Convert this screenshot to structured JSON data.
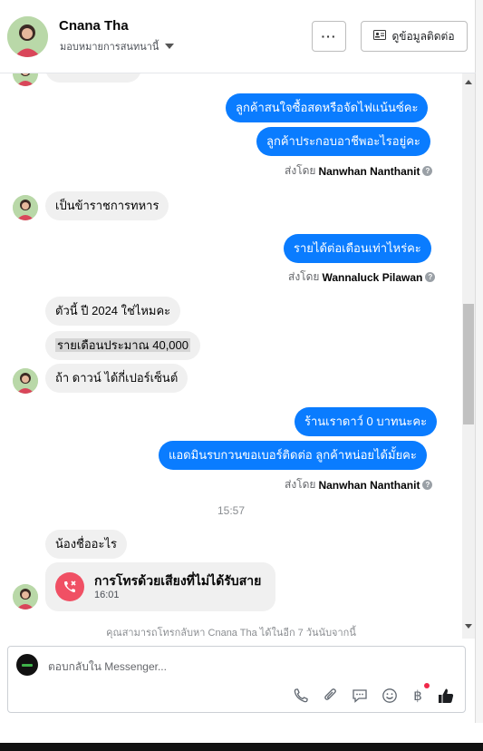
{
  "header": {
    "contact_name": "Cnana Tha",
    "assign_label": "มอบหมายการสนทนานี้",
    "more_label": "···",
    "contact_info_label": "ดูข้อมูลติดต่อ"
  },
  "messages": {
    "out1": "ลูกค้าสนใจซื้อสดหรือจัดไฟแน้นซ์คะ",
    "out2": "ลูกค้าประกอบอาชีพอะไรอยู่คะ",
    "sent1_prefix": "ส่งโดย",
    "sent1_name": "Nanwhan Nanthanit",
    "in1": "เป็นข้าราชการทหาร",
    "out3": "รายได้ต่อเดือนเท่าไหร่คะ",
    "sent2_prefix": "ส่งโดย",
    "sent2_name": "Wannaluck Pilawan",
    "in2": "ตัวนี้ ปี 2024 ใช่ไหมคะ",
    "in3": "รายเดือนประมาณ 40,000",
    "in4": "ถ้า ดาวน์ ได้กี่เปอร์เซ็นต์",
    "out4": "ร้านเราดาว์ 0 บาทนะคะ",
    "out5": "แอดมินรบกวนขอเบอร์ติดต่อ ลูกค้าหน่อยได้มั้ยคะ",
    "sent3_prefix": "ส่งโดย",
    "sent3_name": "Nanwhan Nanthanit",
    "timestamp": "15:57",
    "in5": "น้องชื่ออะไร",
    "call_title": "การโทรด้วยเสียงที่ไม่ได้รับสาย",
    "call_time": "16:01",
    "callback_note": "คุณสามารถโทรกลับหา Cnana Tha ได้ในอีก 7 วันนับจากนี้"
  },
  "composer": {
    "placeholder": "ตอบกลับใน Messenger..."
  },
  "icons": {
    "call": "phone-icon",
    "attach": "paperclip-icon",
    "saved_replies": "chat-bubble-icon",
    "emoji": "emoji-icon",
    "payment": "baht-icon",
    "like": "thumbs-up-icon"
  },
  "colors": {
    "outgoing_bubble": "#0a7cff",
    "incoming_bubble": "#f0f0f0",
    "missed_call": "#f05064",
    "like": "#1c1e21"
  }
}
